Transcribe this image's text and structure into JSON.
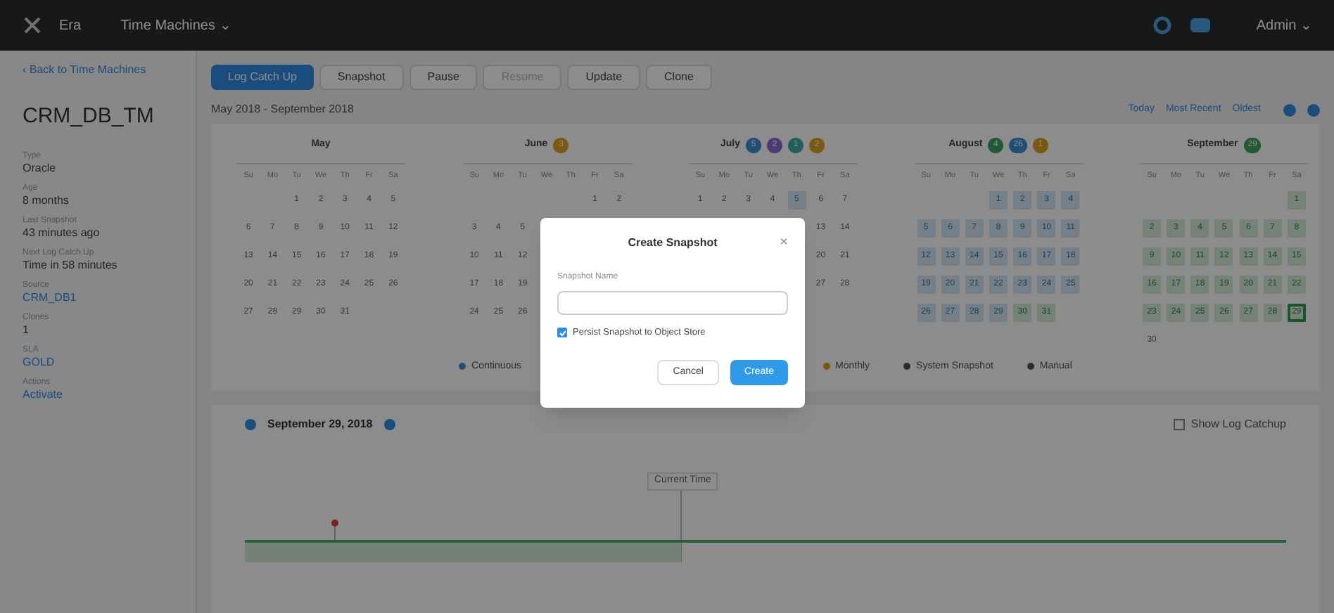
{
  "top_bar": {
    "app": "Era",
    "menu": "Time Machines ⌄",
    "user": "Admin ⌄"
  },
  "sidebar": {
    "back_link": "‹ Back to Time Machines",
    "title": "CRM_DB_TM",
    "fields": [
      {
        "label": "Type",
        "value": "Oracle",
        "kind": "text"
      },
      {
        "label": "Age",
        "value": "8 months",
        "kind": "text"
      },
      {
        "label": "Last Snapshot",
        "value": "43 minutes ago",
        "kind": "text"
      },
      {
        "label": "Next Log Catch Up",
        "value": "Time in 58 minutes",
        "kind": "text"
      },
      {
        "label": "Source",
        "value": "CRM_DB1",
        "kind": "link"
      },
      {
        "label": "Clones",
        "value": "1",
        "kind": "text"
      },
      {
        "label": "SLA",
        "value": "GOLD",
        "kind": "link"
      },
      {
        "label": "Actions",
        "value": "Activate",
        "kind": "link"
      }
    ]
  },
  "toolbar": [
    {
      "label": "Log Catch Up",
      "kind": "primary",
      "disabled": false
    },
    {
      "label": "Snapshot",
      "kind": "default",
      "disabled": false
    },
    {
      "label": "Pause",
      "kind": "default",
      "disabled": false
    },
    {
      "label": "Resume",
      "kind": "default",
      "disabled": true
    },
    {
      "label": "Update",
      "kind": "default",
      "disabled": false
    },
    {
      "label": "Clone",
      "kind": "default",
      "disabled": false
    }
  ],
  "range": "May 2018 - September 2018",
  "nav_links": [
    "Today",
    "Most Recent",
    "Oldest"
  ],
  "months": [
    {
      "name": "May",
      "weekdays": [
        "Su",
        "Mo",
        "Tu",
        "We",
        "Th",
        "Fr",
        "Sa"
      ],
      "weeks": [
        {
          "kind": "end",
          "days": [
            {
              "d": "1",
              "kind": "plain"
            },
            {
              "d": "2",
              "kind": "plain"
            },
            {
              "d": "3",
              "kind": "plain"
            },
            {
              "d": "4",
              "kind": "plain"
            },
            {
              "d": "5",
              "kind": "plain"
            }
          ]
        },
        {
          "kind": "start",
          "days": [
            {
              "d": "6",
              "kind": "plain"
            },
            {
              "d": "7",
              "kind": "plain"
            },
            {
              "d": "8",
              "kind": "plain"
            },
            {
              "d": "9",
              "kind": "plain"
            },
            {
              "d": "10",
              "kind": "plain"
            },
            {
              "d": "11",
              "kind": "plain"
            },
            {
              "d": "12",
              "kind": "plain"
            }
          ]
        },
        {
          "kind": "start",
          "days": [
            {
              "d": "13",
              "kind": "plain"
            },
            {
              "d": "14",
              "kind": "plain"
            },
            {
              "d": "15",
              "kind": "plain"
            },
            {
              "d": "16",
              "kind": "plain"
            },
            {
              "d": "17",
              "kind": "plain"
            },
            {
              "d": "18",
              "kind": "plain"
            },
            {
              "d": "19",
              "kind": "plain"
            }
          ]
        },
        {
          "kind": "start",
          "days": [
            {
              "d": "20",
              "kind": "plain"
            },
            {
              "d": "21",
              "kind": "plain"
            },
            {
              "d": "22",
              "kind": "plain"
            },
            {
              "d": "23",
              "kind": "plain"
            },
            {
              "d": "24",
              "kind": "plain"
            },
            {
              "d": "25",
              "kind": "plain"
            },
            {
              "d": "26",
              "kind": "plain"
            }
          ]
        },
        {
          "kind": "start",
          "days": [
            {
              "d": "27",
              "kind": "plain"
            },
            {
              "d": "28",
              "kind": "plain"
            },
            {
              "d": "29",
              "kind": "plain"
            },
            {
              "d": "30",
              "kind": "plain"
            },
            {
              "d": "31",
              "kind": "plain"
            }
          ]
        }
      ]
    },
    {
      "name": "June",
      "badges": [
        {
          "text": "3",
          "color": "#7b5810"
        }
      ],
      "weekdays": [
        "Su",
        "Mo",
        "Tu",
        "We",
        "Th",
        "Fr",
        "Sa"
      ],
      "weeks": [
        {
          "kind": "end",
          "days": [
            {
              "d": "1",
              "kind": "plain"
            },
            {
              "d": "2",
              "kind": "plain"
            }
          ]
        },
        {
          "kind": "start",
          "days": [
            {
              "d": "3",
              "kind": "plain"
            },
            {
              "d": "4",
              "kind": "plain"
            },
            {
              "d": "5",
              "kind": "plain"
            }
          ]
        },
        {
          "kind": "start",
          "days": [
            {
              "d": "10",
              "kind": "plain"
            },
            {
              "d": "11",
              "kind": "plain"
            },
            {
              "d": "12",
              "kind": "plain"
            }
          ]
        },
        {
          "kind": "start",
          "days": [
            {
              "d": "17",
              "kind": "plain"
            },
            {
              "d": "18",
              "kind": "plain"
            },
            {
              "d": "19",
              "kind": "plain"
            }
          ]
        },
        {
          "kind": "start",
          "days": [
            {
              "d": "24",
              "kind": "plain"
            },
            {
              "d": "25",
              "kind": "plain"
            },
            {
              "d": "26",
              "kind": "plain"
            }
          ]
        }
      ]
    },
    {
      "name": "July",
      "badges": [
        {
          "text": "5",
          "color": "#204f77"
        },
        {
          "text": "2",
          "color": "#4e3b72"
        },
        {
          "text": "1",
          "color": "#206058"
        },
        {
          "text": "2",
          "color": "#7b5810"
        }
      ],
      "weekdays": [
        "Su",
        "Mo",
        "Tu",
        "We",
        "Th",
        "Fr",
        "Sa"
      ],
      "weeks": [
        {
          "kind": "start",
          "days": [
            {
              "d": "1",
              "kind": "plain"
            },
            {
              "d": "2",
              "kind": "plain"
            },
            {
              "d": "3",
              "kind": "plain"
            },
            {
              "d": "4",
              "kind": "plain"
            },
            {
              "d": "5",
              "kind": "log"
            },
            {
              "d": "6",
              "kind": "plain"
            },
            {
              "d": "7",
              "kind": "plain"
            }
          ]
        },
        {
          "kind": "end",
          "days": [
            {
              "d": "13",
              "kind": "plain"
            },
            {
              "d": "14",
              "kind": "plain"
            }
          ]
        },
        {
          "kind": "end",
          "days": [
            {
              "d": "20",
              "kind": "plain"
            },
            {
              "d": "21",
              "kind": "plain"
            }
          ]
        },
        {
          "kind": "end",
          "days": [
            {
              "d": "27",
              "kind": "plain"
            },
            {
              "d": "28",
              "kind": "plain"
            }
          ]
        }
      ]
    },
    {
      "name": "August",
      "badges": [
        {
          "text": "4",
          "color": "#205a32"
        },
        {
          "text": "26",
          "color": "#204f77"
        },
        {
          "text": "1",
          "color": "#7b5810"
        }
      ],
      "weekdays": [
        "Su",
        "Mo",
        "Tu",
        "We",
        "Th",
        "Fr",
        "Sa"
      ],
      "weeks": [
        {
          "kind": "end",
          "days": [
            {
              "d": "1",
              "kind": "log"
            },
            {
              "d": "2",
              "kind": "log"
            },
            {
              "d": "3",
              "kind": "log"
            },
            {
              "d": "4",
              "kind": "log"
            }
          ]
        },
        {
          "kind": "start",
          "days": [
            {
              "d": "5",
              "kind": "log"
            },
            {
              "d": "6",
              "kind": "log"
            },
            {
              "d": "7",
              "kind": "log"
            },
            {
              "d": "8",
              "kind": "log"
            },
            {
              "d": "9",
              "kind": "log"
            },
            {
              "d": "10",
              "kind": "log"
            },
            {
              "d": "11",
              "kind": "log"
            }
          ]
        },
        {
          "kind": "start",
          "days": [
            {
              "d": "12",
              "kind": "log"
            },
            {
              "d": "13",
              "kind": "log"
            },
            {
              "d": "14",
              "kind": "log"
            },
            {
              "d": "15",
              "kind": "log"
            },
            {
              "d": "16",
              "kind": "log"
            },
            {
              "d": "17",
              "kind": "log"
            },
            {
              "d": "18",
              "kind": "log"
            }
          ]
        },
        {
          "kind": "start",
          "days": [
            {
              "d": "19",
              "kind": "log"
            },
            {
              "d": "20",
              "kind": "log"
            },
            {
              "d": "21",
              "kind": "log"
            },
            {
              "d": "22",
              "kind": "log"
            },
            {
              "d": "23",
              "kind": "log"
            },
            {
              "d": "24",
              "kind": "log"
            },
            {
              "d": "25",
              "kind": "log"
            }
          ]
        },
        {
          "kind": "start",
          "days": [
            {
              "d": "26",
              "kind": "log"
            },
            {
              "d": "27",
              "kind": "log"
            },
            {
              "d": "28",
              "kind": "log"
            },
            {
              "d": "29",
              "kind": "log"
            },
            {
              "d": "30",
              "kind": "snapshot"
            },
            {
              "d": "31",
              "kind": "snapshot"
            }
          ]
        }
      ]
    },
    {
      "name": "September",
      "badges": [
        {
          "text": "29",
          "color": "#205a32"
        }
      ],
      "weekdays": [
        "Su",
        "Mo",
        "Tu",
        "We",
        "Th",
        "Fr",
        "Sa"
      ],
      "weeks": [
        {
          "kind": "end",
          "days": [
            {
              "d": "1",
              "kind": "snapshot"
            }
          ]
        },
        {
          "kind": "start",
          "days": [
            {
              "d": "2",
              "kind": "snapshot"
            },
            {
              "d": "3",
              "kind": "snapshot"
            },
            {
              "d": "4",
              "kind": "snapshot"
            },
            {
              "d": "5",
              "kind": "snapshot"
            },
            {
              "d": "6",
              "kind": "snapshot"
            },
            {
              "d": "7",
              "kind": "snapshot"
            },
            {
              "d": "8",
              "kind": "snapshot"
            }
          ]
        },
        {
          "kind": "start",
          "days": [
            {
              "d": "9",
              "kind": "snapshot"
            },
            {
              "d": "10",
              "kind": "snapshot"
            },
            {
              "d": "11",
              "kind": "snapshot"
            },
            {
              "d": "12",
              "kind": "snapshot"
            },
            {
              "d": "13",
              "kind": "snapshot"
            },
            {
              "d": "14",
              "kind": "snapshot"
            },
            {
              "d": "15",
              "kind": "snapshot"
            }
          ]
        },
        {
          "kind": "start",
          "days": [
            {
              "d": "16",
              "kind": "snapshot"
            },
            {
              "d": "17",
              "kind": "snapshot"
            },
            {
              "d": "18",
              "kind": "snapshot"
            },
            {
              "d": "19",
              "kind": "snapshot"
            },
            {
              "d": "20",
              "kind": "snapshot"
            },
            {
              "d": "21",
              "kind": "snapshot"
            },
            {
              "d": "22",
              "kind": "snapshot"
            }
          ]
        },
        {
          "kind": "start",
          "days": [
            {
              "d": "23",
              "kind": "snapshot"
            },
            {
              "d": "24",
              "kind": "snapshot"
            },
            {
              "d": "25",
              "kind": "snapshot"
            },
            {
              "d": "26",
              "kind": "snapshot"
            },
            {
              "d": "27",
              "kind": "snapshot"
            },
            {
              "d": "28",
              "kind": "snapshot"
            },
            {
              "d": "29",
              "kind": "selected"
            }
          ]
        },
        {
          "kind": "start",
          "days": [
            {
              "d": "30",
              "kind": "plain"
            }
          ]
        }
      ]
    }
  ],
  "legend": [
    {
      "label": "Continuous",
      "color": "#204f77"
    },
    {
      "label": "Monthly",
      "color": "#7b5810"
    },
    {
      "label": "System Snapshot",
      "color": "#2f2f2f"
    },
    {
      "label": "Manual",
      "color": "#2f2f2f"
    }
  ],
  "timeline": {
    "date": "September 29, 2018",
    "show_log_catchup": {
      "label": "Show Log Catchup",
      "checked": false
    },
    "current_label": "Current Time"
  },
  "dialog": {
    "title": "Create Snapshot",
    "close": "×",
    "field_label": "Snapshot Name",
    "persist": {
      "label": "Persist Snapshot to Object Store",
      "checked": true
    },
    "buttons": [
      {
        "label": "Cancel",
        "kind": "default"
      },
      {
        "label": "Create",
        "kind": "primary"
      }
    ]
  }
}
